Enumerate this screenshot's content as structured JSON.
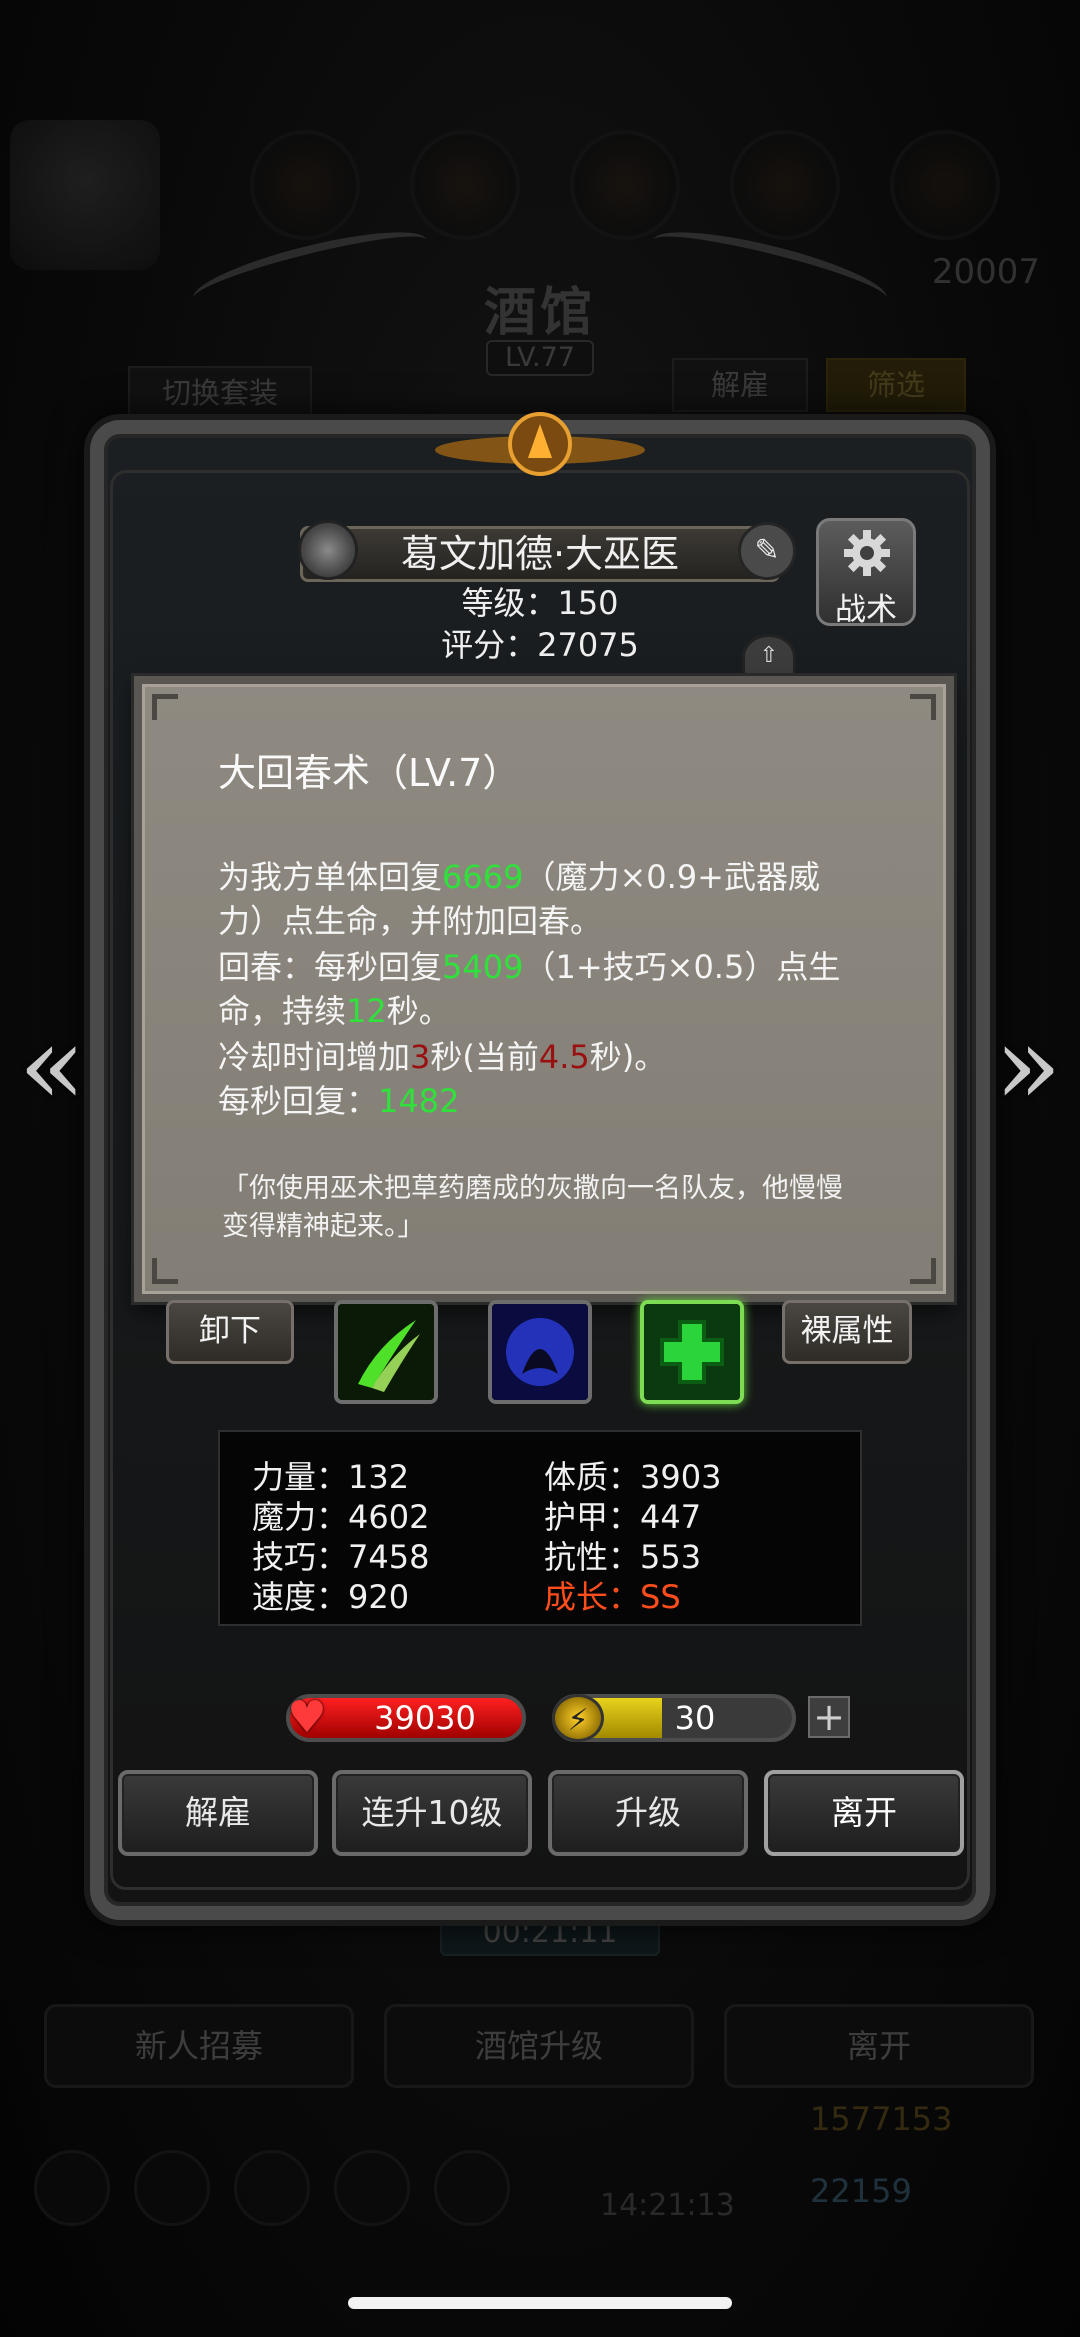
{
  "background": {
    "title": "酒馆",
    "level": "LV.77",
    "switch_outfit_label": "切换套装",
    "dismiss_top_label": "解雇",
    "filter_label": "筛选",
    "gold_partial": "20007",
    "timer": "00:21:11",
    "recruit_label": "新人招募",
    "tavern_upgrade_label": "酒馆升级",
    "leave_label": "离开",
    "resource_gold": "1577153",
    "resource_gem": "22159",
    "clock": "14:21:13"
  },
  "hero": {
    "name": "葛文加德·大巫医",
    "level_text": "等级：150",
    "score_text": "评分：27075",
    "tactics_label": "战术"
  },
  "skill_tooltip": {
    "title": "大回春术（LV.7）",
    "line1_a": "为我方单体回复",
    "line1_val": "6669",
    "line1_b": "（魔力×0.9+武器威",
    "line2": "力）点生命，并附加回春。",
    "line3_a": "回春：每秒回复",
    "line3_val": "5409",
    "line3_b": "（1+技巧×0.5）点生",
    "line4_a": "命，持续",
    "line4_val": "12",
    "line4_b": "秒。",
    "line5_a": "冷却时间增加",
    "line5_val": "3",
    "line5_b": "秒(当前",
    "line5_val2": "4.5",
    "line5_c": "秒)。",
    "line6_a": "每秒回复：",
    "line6_val": "1482",
    "lore1": "「你使用巫术把草药磨成的灰撒向一名队友，他慢慢",
    "lore2": "变得精神起来。」"
  },
  "equip": {
    "unequip_label": "卸下",
    "naked_stats_label": "裸属性"
  },
  "stats": {
    "strength": "力量：132",
    "magic": "魔力：4602",
    "skill": "技巧：7458",
    "speed": "速度：920",
    "constitution": "体质：3903",
    "armor": "护甲：447",
    "resistance": "抗性：553",
    "growth": "成长：SS"
  },
  "bars": {
    "hp": "39030",
    "energy": "30",
    "energy_fill_fraction": 0.45,
    "plus": "+"
  },
  "actions": {
    "dismiss": "解雇",
    "upgrade10": "连升10级",
    "upgrade": "升级",
    "leave": "离开"
  },
  "colors": {
    "highlight_green": "#2fe13a",
    "highlight_red": "#9a1010",
    "growth_orange": "#ff4d1c"
  }
}
